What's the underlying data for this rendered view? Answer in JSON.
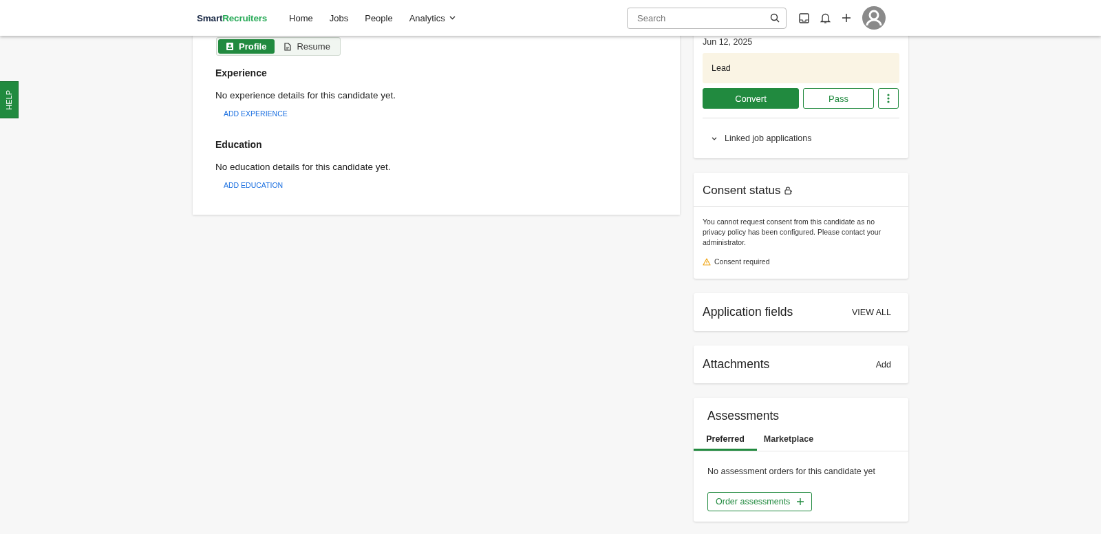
{
  "header": {
    "logo": {
      "first": "Smart",
      "second": "Recruiters"
    },
    "nav": [
      {
        "label": "Home",
        "dropdown": false
      },
      {
        "label": "Jobs",
        "dropdown": false
      },
      {
        "label": "People",
        "dropdown": false
      },
      {
        "label": "Analytics",
        "dropdown": true
      }
    ],
    "search": {
      "placeholder": "Search"
    }
  },
  "help_tab": {
    "label": "HELP"
  },
  "profile": {
    "view_toggle": [
      {
        "label": "Profile",
        "selected": true
      },
      {
        "label": "Resume",
        "selected": false
      }
    ],
    "sections": [
      {
        "title": "Experience",
        "empty_text": "No experience details for this candidate yet.",
        "action": "ADD EXPERIENCE"
      },
      {
        "title": "Education",
        "empty_text": "No education details for this candidate yet.",
        "action": "ADD EDUCATION"
      }
    ]
  },
  "status_card": {
    "date": "Jun 12, 2025",
    "status": "Lead",
    "actions": [
      {
        "label": "Convert",
        "kind": "primary"
      },
      {
        "label": "Pass",
        "kind": "secondary"
      }
    ],
    "linked": {
      "label": "Linked job applications",
      "expanded": false
    }
  },
  "consent": {
    "title": "Consent status",
    "message": "You cannot request consent from this candidate as no privacy policy has been configured. Please contact your administrator.",
    "warning": "Consent required"
  },
  "application_fields": {
    "title": "Application fields",
    "action": "VIEW ALL"
  },
  "attachments": {
    "title": "Attachments",
    "action": "Add"
  },
  "assessments": {
    "title": "Assessments",
    "tabs": [
      {
        "label": "Preferred",
        "selected": true
      },
      {
        "label": "Marketplace",
        "selected": false
      }
    ],
    "empty_text": "No assessment orders for this candidate yet",
    "order_button": "Order assessments"
  }
}
